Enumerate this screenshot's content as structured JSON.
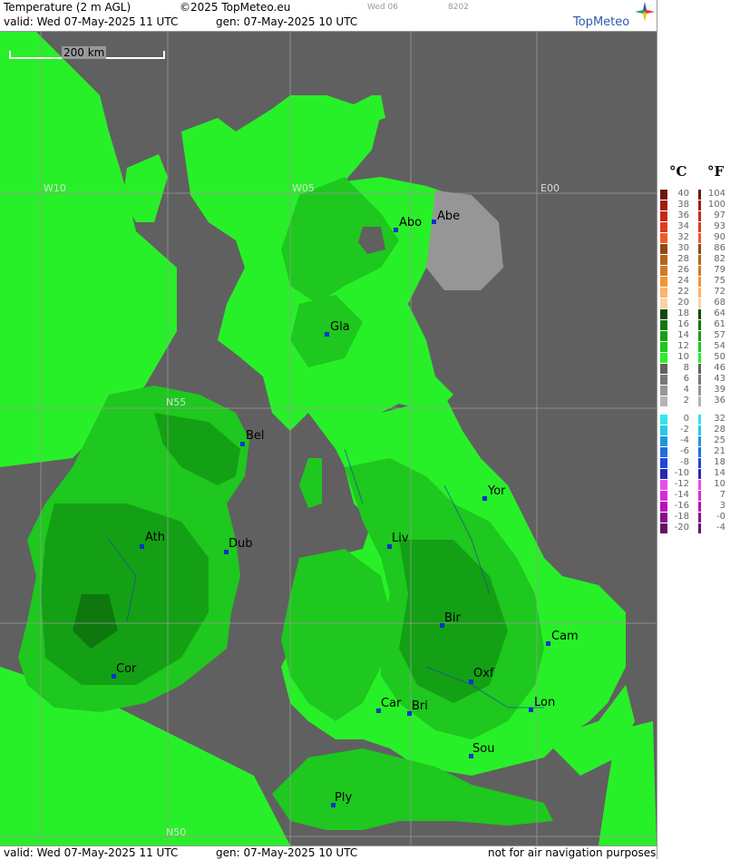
{
  "header": {
    "title": "Temperature (2 m AGL)",
    "copyright": "©2025 TopMeteo.eu",
    "valid": "valid:  Wed  07-May-2025  11 UTC",
    "gen": "gen:  07-May-2025 10 UTC",
    "day_small": "Wed 06",
    "code_small": "8202",
    "brand": "TopMeteo"
  },
  "scale_bar": {
    "label": "200 km"
  },
  "coords": {
    "w10": "W10",
    "w05": "W05",
    "e00": "E00",
    "n55": "N55",
    "n50": "N50"
  },
  "cities": [
    {
      "name": "Abo"
    },
    {
      "name": "Abe"
    },
    {
      "name": "Gla"
    },
    {
      "name": "Bel"
    },
    {
      "name": "Yor"
    },
    {
      "name": "Ath"
    },
    {
      "name": "Dub"
    },
    {
      "name": "Liv"
    },
    {
      "name": "Bir"
    },
    {
      "name": "Cam"
    },
    {
      "name": "Cor"
    },
    {
      "name": "Oxf"
    },
    {
      "name": "Car"
    },
    {
      "name": "Bri"
    },
    {
      "name": "Lon"
    },
    {
      "name": "Sou"
    },
    {
      "name": "Ply"
    }
  ],
  "legend": {
    "celsius_label": "°C",
    "fahrenheit_label": "°F",
    "entries": [
      {
        "c": "40",
        "f": "104",
        "color": "#6b1a0a"
      },
      {
        "c": "38",
        "f": "100",
        "color": "#a01e0e"
      },
      {
        "c": "36",
        "f": "97",
        "color": "#c82814"
      },
      {
        "c": "34",
        "f": "93",
        "color": "#e03c1e"
      },
      {
        "c": "32",
        "f": "90",
        "color": "#f05a28"
      },
      {
        "c": "30",
        "f": "86",
        "color": "#8c4a14"
      },
      {
        "c": "28",
        "f": "82",
        "color": "#b4641e"
      },
      {
        "c": "26",
        "f": "79",
        "color": "#d27828"
      },
      {
        "c": "24",
        "f": "75",
        "color": "#f09632"
      },
      {
        "c": "22",
        "f": "72",
        "color": "#fab46e"
      },
      {
        "c": "20",
        "f": "68",
        "color": "#fcd2a0"
      },
      {
        "c": "18",
        "f": "64",
        "color": "#0a4a0a"
      },
      {
        "c": "16",
        "f": "61",
        "color": "#0e780e"
      },
      {
        "c": "14",
        "f": "57",
        "color": "#14a014"
      },
      {
        "c": "12",
        "f": "54",
        "color": "#1ec81e"
      },
      {
        "c": "10",
        "f": "50",
        "color": "#28f028"
      },
      {
        "c": "8",
        "f": "46",
        "color": "#606060"
      },
      {
        "c": "6",
        "f": "43",
        "color": "#787878"
      },
      {
        "c": "4",
        "f": "39",
        "color": "#969696"
      },
      {
        "c": "2",
        "f": "36",
        "color": "#b4b4b4"
      },
      {
        "c": "0",
        "f": "32",
        "color": "#32e6f0"
      },
      {
        "c": "-2",
        "f": "28",
        "color": "#28c8e6"
      },
      {
        "c": "-4",
        "f": "25",
        "color": "#1e96dc"
      },
      {
        "c": "-6",
        "f": "21",
        "color": "#1e6edc"
      },
      {
        "c": "-8",
        "f": "18",
        "color": "#1e46dc"
      },
      {
        "c": "-10",
        "f": "14",
        "color": "#2828b4"
      },
      {
        "c": "-12",
        "f": "10",
        "color": "#e650e6"
      },
      {
        "c": "-14",
        "f": "7",
        "color": "#dc28dc"
      },
      {
        "c": "-16",
        "f": "3",
        "color": "#b414b4"
      },
      {
        "c": "-18",
        "f": "-0",
        "color": "#8c0a8c"
      },
      {
        "c": "-20",
        "f": "-4",
        "color": "#641464"
      }
    ]
  },
  "footer": {
    "valid": "valid:  Wed  07-May-2025  11 UTC",
    "gen": "gen:  07-May-2025 10 UTC",
    "note": "not for air navigation purposes"
  }
}
